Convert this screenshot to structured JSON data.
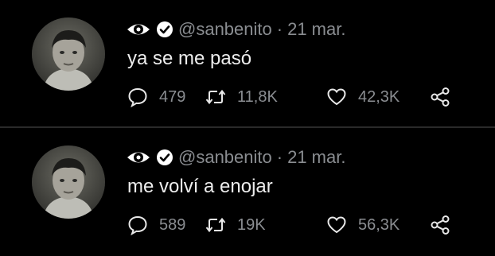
{
  "tweets": [
    {
      "handle": "@sanbenito",
      "separator": "·",
      "date": "21 mar.",
      "text": "ya se me pasó",
      "replies": "479",
      "retweets": "11,8K",
      "likes": "42,3K"
    },
    {
      "handle": "@sanbenito",
      "separator": "·",
      "date": "21 mar.",
      "text": "me volví a enojar",
      "replies": "589",
      "retweets": "19K",
      "likes": "56,3K"
    }
  ],
  "colors": {
    "background": "#000000",
    "primary_text": "#ededed",
    "secondary_text": "#8a8d91",
    "divider": "#2a2a2a"
  },
  "icons": [
    "eye-icon",
    "verified-icon",
    "reply-icon",
    "retweet-icon",
    "like-icon",
    "share-icon"
  ]
}
